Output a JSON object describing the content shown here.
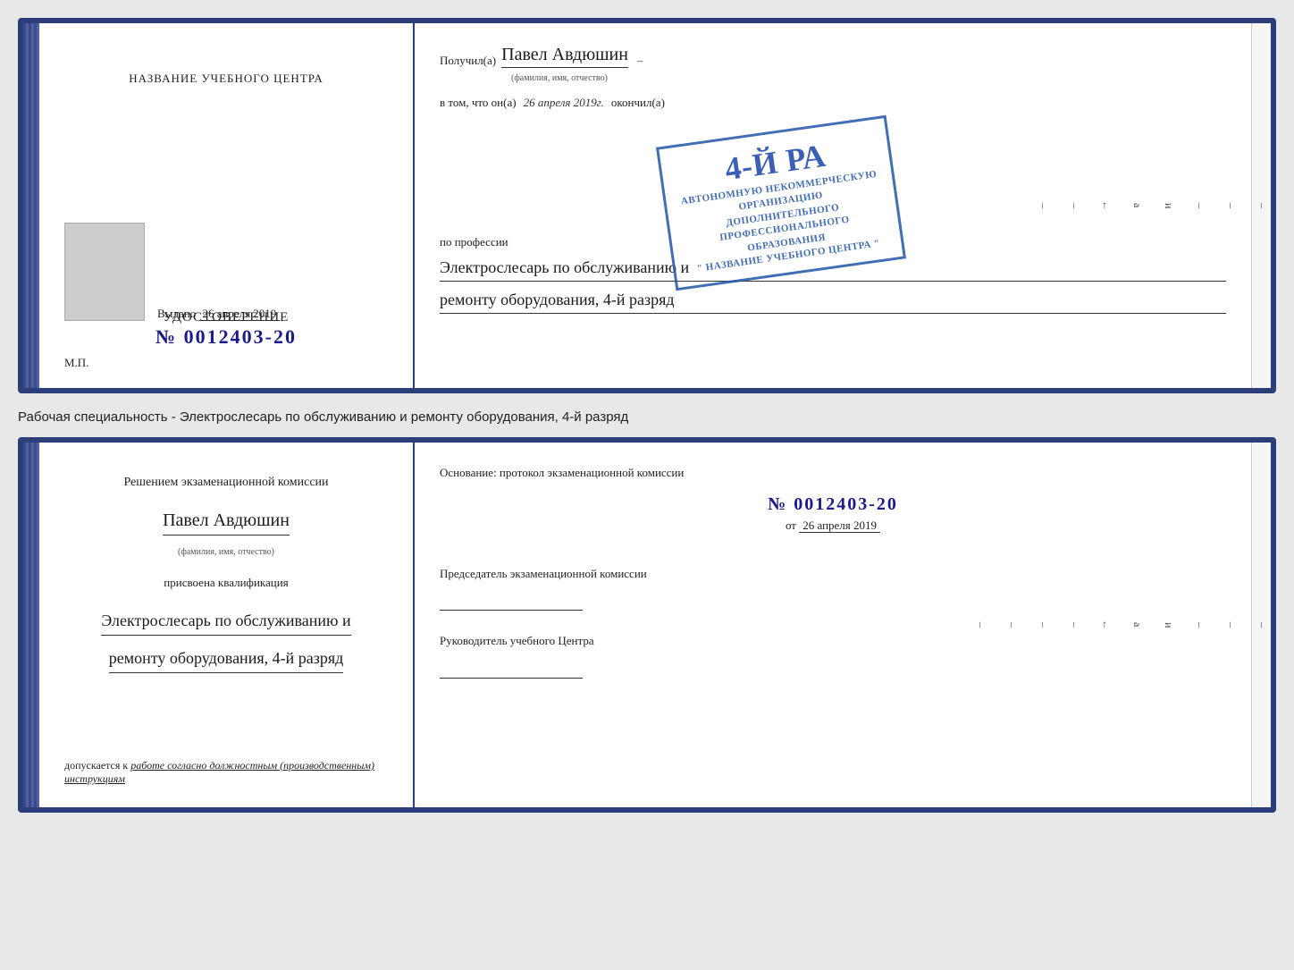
{
  "top_doc": {
    "left_page": {
      "center_title": "НАЗВАНИЕ УЧЕБНОГО ЦЕНТРА",
      "udost_title": "УДОСТОВЕРЕНИЕ",
      "udost_number": "№ 0012403-20",
      "vydano_label": "Выдано",
      "vydano_date": "26 апреля 2019",
      "mp_label": "М.П."
    },
    "right_page": {
      "poluchil_label": "Получил(а)",
      "recipient_name": "Павел Авдюшин",
      "fio_caption": "(фамилия, имя, отчество)",
      "vtom_label": "в том, что он(а)",
      "vtom_date": "26 апреля 2019г.",
      "okonchil_label": "окончил(а)",
      "stamp_line1": "АВТОНОМНУЮ НЕКОММЕРЧЕСКУЮ ОРГАНИЗАЦИЮ",
      "stamp_line2": "ДОПОЛНИТЕЛЬНОГО ПРОФЕССИОНАЛЬНОГО ОБРАЗОВАНИЯ",
      "stamp_line3": "\" НАЗВАНИЕ УЧЕБНОГО ЦЕНТРА \"",
      "stamp_big": "4-й ра",
      "po_professii_label": "по профессии",
      "profession_line1": "Электрослесарь по обслуживанию и",
      "profession_line2": "ремонту оборудования, 4-й разряд"
    }
  },
  "between_text": "Рабочая специальность - Электрослесарь по обслуживанию и ремонту оборудования, 4-й разряд",
  "bottom_doc": {
    "left_page": {
      "komissia_title": "Решением экзаменационной комиссии",
      "person_name": "Павел Авдюшин",
      "fio_caption": "(фамилия, имя, отчество)",
      "prisvoena_label": "присвоена квалификация",
      "kvalif_line1": "Электрослесарь по обслуживанию и",
      "kvalif_line2": "ремонту оборудования, 4-й разряд",
      "dopusk_label": "допускается к",
      "dopusk_text": "работе согласно должностным (производственным) инструкциям"
    },
    "right_page": {
      "osnovanie_label": "Основание: протокол экзаменационной комиссии",
      "protocol_number": "№ 0012403-20",
      "ot_label": "от",
      "ot_date": "26 апреля 2019",
      "predsedatel_label": "Председатель экзаменационной комиссии",
      "rukovoditel_label": "Руководитель учебного Центра"
    }
  },
  "right_annotations": {
    "chars": [
      "и",
      "а",
      "←",
      "–",
      "–",
      "–",
      "–",
      "–"
    ]
  }
}
